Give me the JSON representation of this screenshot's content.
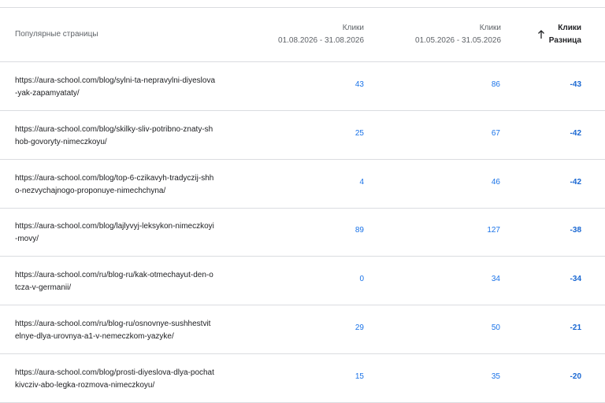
{
  "header": {
    "page_label": "Популярные страницы",
    "col1_title": "Клики",
    "col1_range": "01.08.2026 - 31.08.2026",
    "col2_title": "Клики",
    "col2_range": "01.05.2026 - 31.05.2026",
    "col3_title": "Клики",
    "col3_sub": "Разница"
  },
  "rows": [
    {
      "url": "https://aura-school.com/blog/sylni-ta-nepravylni-diyeslova-yak-zapamyataty/",
      "line1": "https://aura-school.com/blog/sylni-ta-nepravylni-diyeslova",
      "line2": "-yak-zapamyataty/",
      "c1": "43",
      "c2": "86",
      "diff": "-43"
    },
    {
      "url": "https://aura-school.com/blog/skilky-sliv-potribno-znaty-shhob-govoryty-nimeczkoyu/",
      "line1": "https://aura-school.com/blog/skilky-sliv-potribno-znaty-sh",
      "line2": "hob-govoryty-nimeczkoyu/",
      "c1": "25",
      "c2": "67",
      "diff": "-42"
    },
    {
      "url": "https://aura-school.com/blog/top-6-czikavyh-tradyczij-shho-nezvychajnogo-proponuye-nimechchyna/",
      "line1": "https://aura-school.com/blog/top-6-czikavyh-tradyczij-shh",
      "line2": "o-nezvychajnogo-proponuye-nimechchyna/",
      "c1": "4",
      "c2": "46",
      "diff": "-42"
    },
    {
      "url": "https://aura-school.com/blog/lajlyvyj-leksykon-nimeczkoyi-movy/",
      "line1": "https://aura-school.com/blog/lajlyvyj-leksykon-nimeczkoyi",
      "line2": "-movy/",
      "c1": "89",
      "c2": "127",
      "diff": "-38"
    },
    {
      "url": "https://aura-school.com/ru/blog-ru/kak-otmechayut-den-otcza-v-germanii/",
      "line1": "https://aura-school.com/ru/blog-ru/kak-otmechayut-den-o",
      "line2": "tcza-v-germanii/",
      "c1": "0",
      "c2": "34",
      "diff": "-34"
    },
    {
      "url": "https://aura-school.com/ru/blog-ru/osnovnye-sushhestvitelnye-dlya-urovnya-a1-v-nemeczkom-yazyke/",
      "line1": "https://aura-school.com/ru/blog-ru/osnovnye-sushhestvit",
      "line2": "elnye-dlya-urovnya-a1-v-nemeczkom-yazyke/",
      "c1": "29",
      "c2": "50",
      "diff": "-21"
    },
    {
      "url": "https://aura-school.com/blog/prosti-diyeslova-dlya-pochatkivcziv-abo-legka-rozmova-nimeczkoyu/",
      "line1": "https://aura-school.com/blog/prosti-diyeslova-dlya-pochat",
      "line2": "kivcziv-abo-legka-rozmova-nimeczkoyu/",
      "c1": "15",
      "c2": "35",
      "diff": "-20"
    }
  ]
}
